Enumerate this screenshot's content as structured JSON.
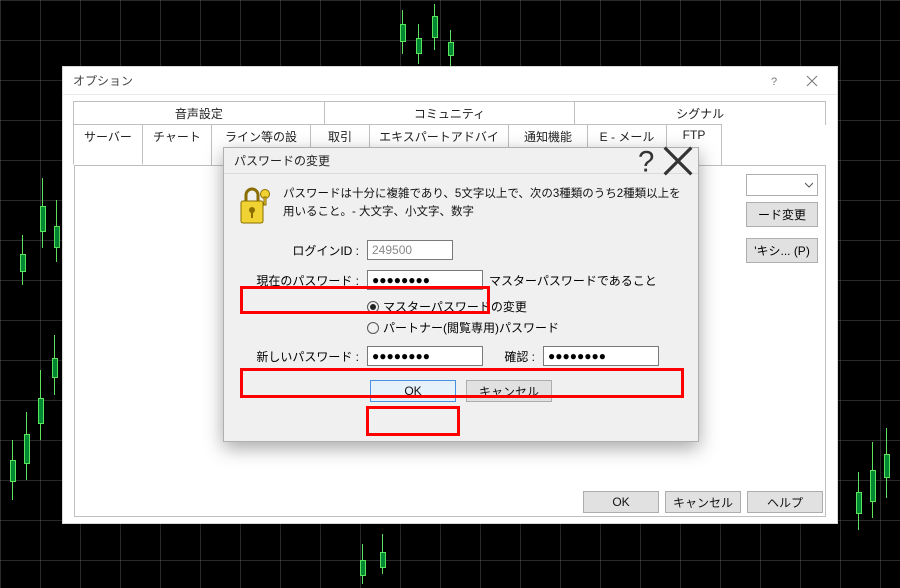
{
  "options_dialog": {
    "title": "オプション",
    "tabs_row1": [
      {
        "label": "音声設定"
      },
      {
        "label": "コミュニティ"
      },
      {
        "label": "シグナル"
      }
    ],
    "tabs_row2": [
      {
        "label": "サーバー",
        "active": true
      },
      {
        "label": "チャート"
      },
      {
        "label": "ライン等の設定"
      },
      {
        "label": "取引"
      },
      {
        "label": "エキスパートアドバイザ"
      },
      {
        "label": "通知機能"
      },
      {
        "label": "E - メール"
      },
      {
        "label": "FTP"
      }
    ],
    "buttons": {
      "ok": "OK",
      "cancel": "キャンセル",
      "help": "ヘルプ"
    },
    "peek": {
      "btn1": "ード変更",
      "btn2": "'キシ... (P)"
    }
  },
  "pw_dialog": {
    "title": "パスワードの変更",
    "instructions": "パスワードは十分に複雑であり、5文字以上で、次の3種類のうち2種類以上を用いること。- 大文字、小文字、数字",
    "labels": {
      "login_id": "ログインID :",
      "current_pw": "現在のパスワード :",
      "new_pw": "新しいパスワード :",
      "confirm": "確認 :",
      "radio_master": "マスターパスワードの変更",
      "radio_partner": "パートナー(閲覧専用)パスワード",
      "current_note": "マスターパスワードであること"
    },
    "values": {
      "login_id": "249500",
      "current_pw": "●●●●●●●●",
      "new_pw": "●●●●●●●●",
      "confirm": "●●●●●●●●"
    },
    "buttons": {
      "ok": "OK",
      "cancel": "キャンセル"
    }
  }
}
